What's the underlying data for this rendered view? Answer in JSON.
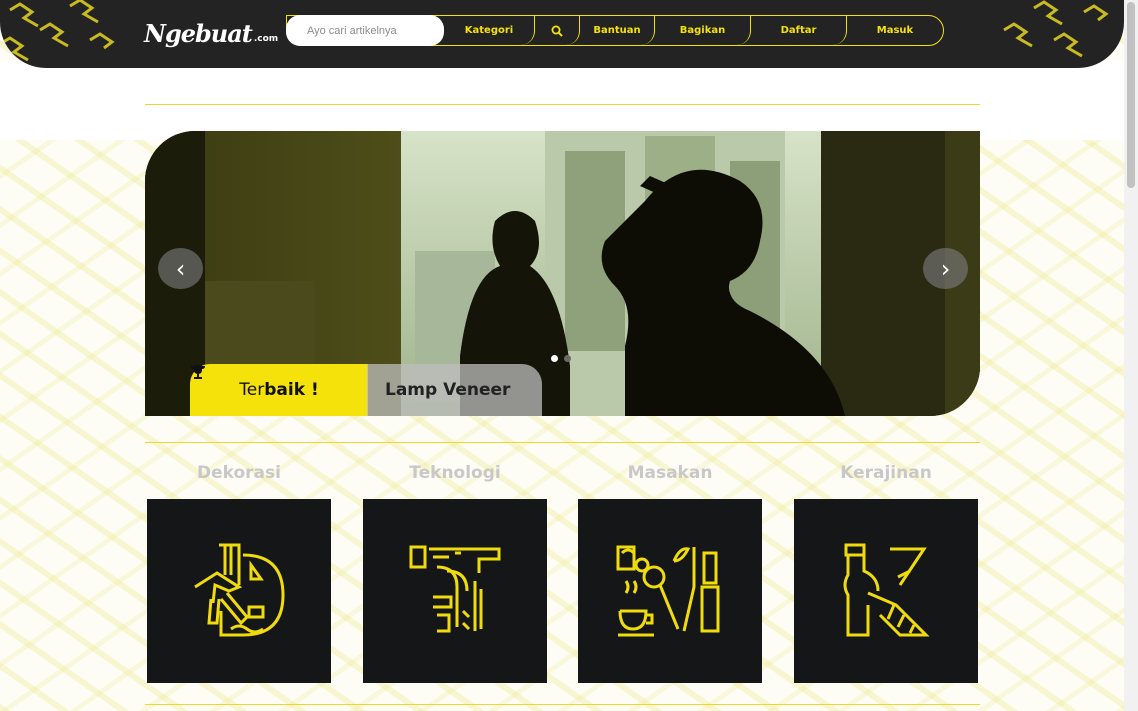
{
  "header": {
    "logo": "Ngebuat",
    "logo_suffix": ".com",
    "search_placeholder": "Ayo cari artikelnya",
    "nav": {
      "kategori": "Kategori",
      "bantuan": "Bantuan",
      "bagikan": "Bagikan",
      "daftar": "Daftar",
      "masuk": "Masuk"
    }
  },
  "hero": {
    "badge_prefix": "Ter",
    "badge_bold": "baik !",
    "title": "Lamp Veneer",
    "slides": 2,
    "active_slide": 1
  },
  "categories": [
    {
      "label": "Dekorasi"
    },
    {
      "label": "Teknologi"
    },
    {
      "label": "Masakan"
    },
    {
      "label": "Kerajinan"
    }
  ],
  "colors": {
    "accent": "#f5e20a",
    "header_bg": "#232323",
    "tile_bg": "#151617"
  }
}
